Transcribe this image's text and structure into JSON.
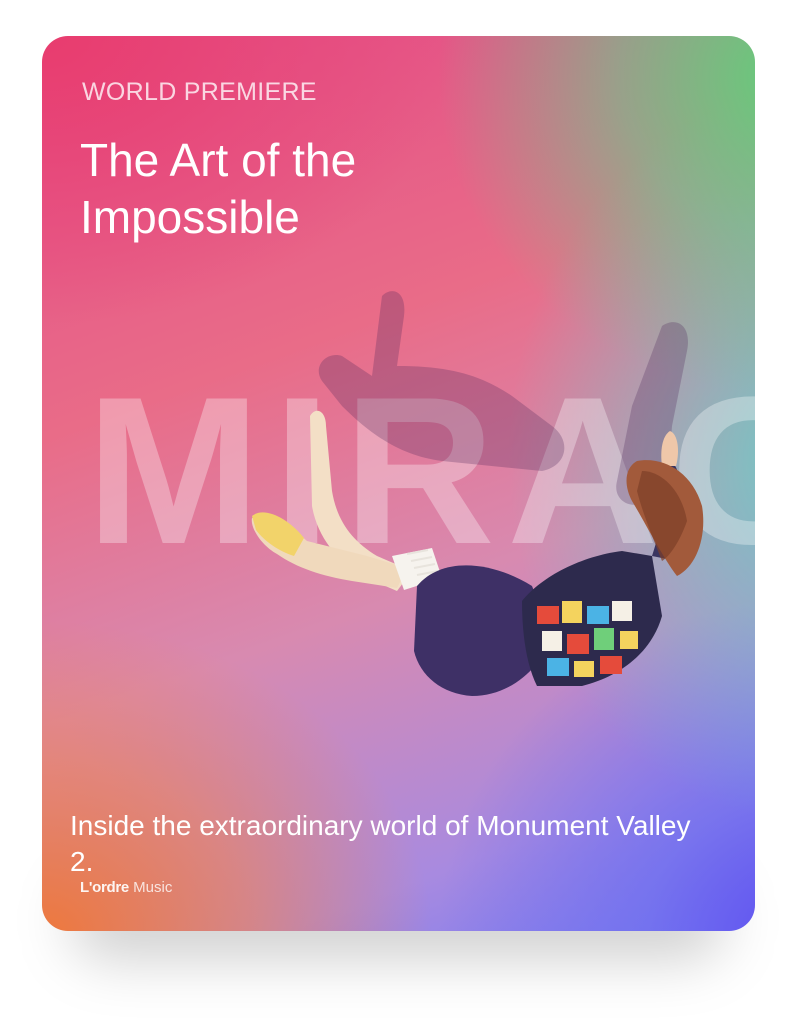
{
  "card": {
    "overline": "WORLD PREMIERE",
    "title": "The Art of the Impossible",
    "background_word": "MIRAG",
    "caption": "Inside the extraordinary world of Monument Valley 2.",
    "brand": {
      "name_bold": "L'ordre",
      "name_light": "Music"
    }
  },
  "colors": {
    "top_left": "#e83c6e",
    "top_right": "#58d678",
    "bottom_left": "#ee783c",
    "bottom_right": "#5f50f0",
    "text": "#ffffff"
  },
  "image": {
    "subject": "falling-woman-illustration"
  }
}
